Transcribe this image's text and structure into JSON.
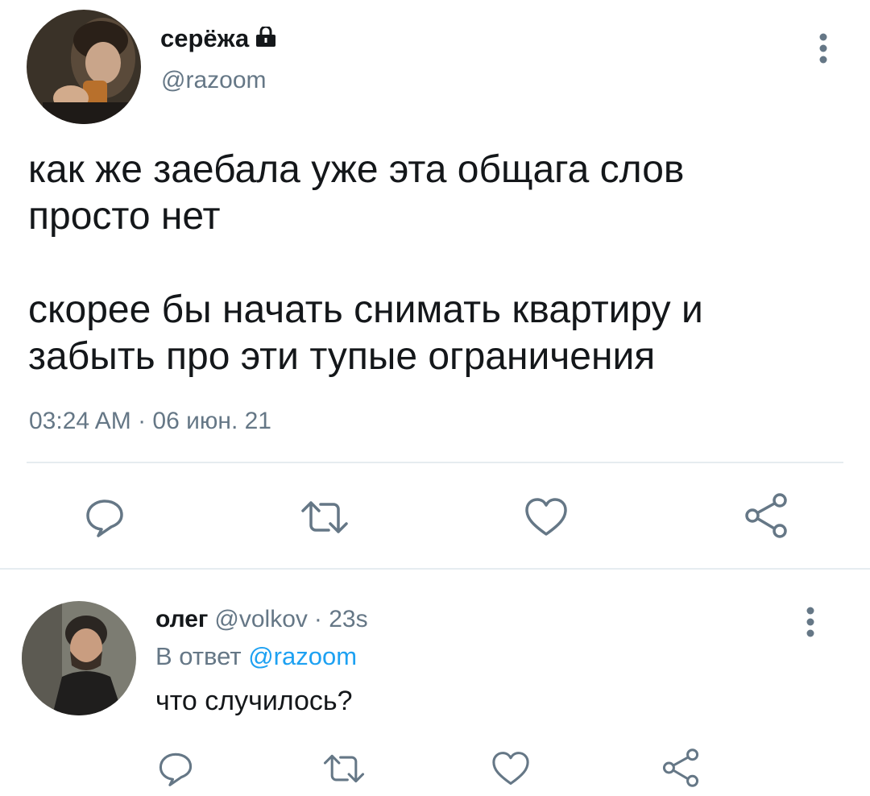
{
  "tweet": {
    "author_name": "серёжа",
    "handle": "@razoom",
    "lock_icon": "lock-icon",
    "body_line1": "как же заебала уже эта общага слов",
    "body_line2": "просто нет",
    "body_line3": "скорее бы начать снимать квартиру и",
    "body_line4": "забыть про эти тупые ограничения",
    "timestamp": "03:24 AM · 06 июн. 21",
    "actions": [
      "reply-icon",
      "retweet-icon",
      "like-icon",
      "share-icon"
    ]
  },
  "reply": {
    "author_name": "олег",
    "handle": "@volkov",
    "time": "· 23s",
    "reply_to_label": "В ответ",
    "reply_to_handle": "@razoom",
    "body": "что случилось?",
    "actions": [
      "reply-icon",
      "retweet-icon",
      "like-icon",
      "share-icon"
    ]
  },
  "colors": {
    "text": "#14171a",
    "muted": "#657786",
    "link": "#1da1f2",
    "divider": "#e6ecf0"
  }
}
